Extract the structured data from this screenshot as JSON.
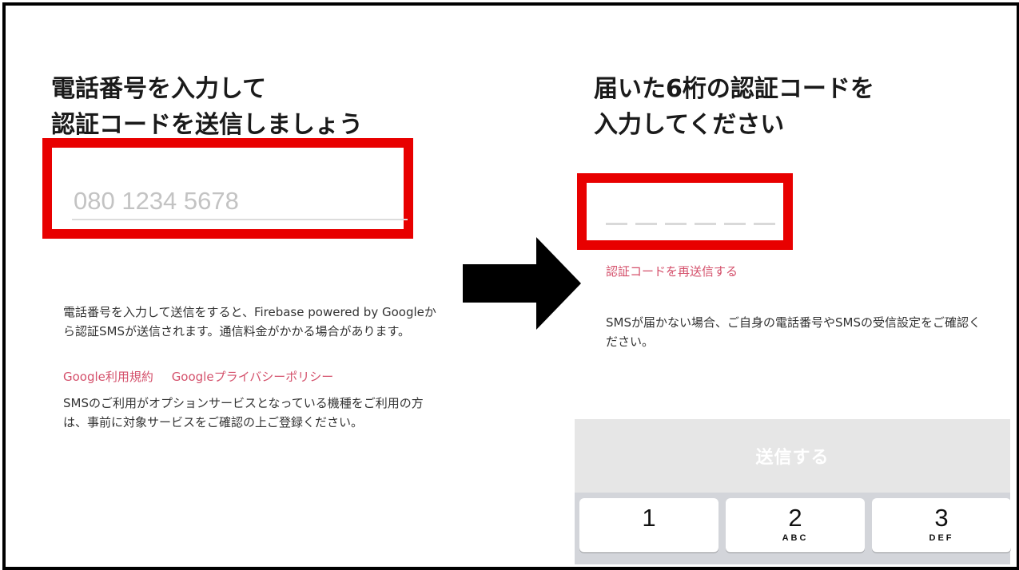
{
  "left": {
    "title_line1": "電話番号を入力して",
    "title_line2": "認証コードを送信しましょう",
    "phone_placeholder": "080 1234 5678",
    "description": "電話番号を入力して送信をすると、Firebase powered by Googleから認証SMSが送信されます。通信料金がかかる場合があります。",
    "links": [
      "Google利用規約",
      "Googleプライバシーポリシー"
    ],
    "note": "SMSのご利用がオプションサービスとなっている機種をご利用の方は、事前に対象サービスをご確認の上ご登録ください。"
  },
  "right": {
    "title_line1": "届いた6桁の認証コードを",
    "title_line2": "入力してください",
    "code_slots": 6,
    "resend_link": "認証コードを再送信する",
    "sms_note": "SMSが届かない場合、ご自身の電話番号やSMSの受信設定をご確認ください。",
    "submit_label": "送信する",
    "keypad": [
      {
        "number": "1",
        "letters": ""
      },
      {
        "number": "2",
        "letters": "ABC"
      },
      {
        "number": "3",
        "letters": "DEF"
      }
    ]
  },
  "colors": {
    "highlight_border": "#e80000",
    "link": "#d4506b",
    "arrow": "#000000"
  },
  "icons": {
    "arrow": "right-arrow-icon"
  }
}
